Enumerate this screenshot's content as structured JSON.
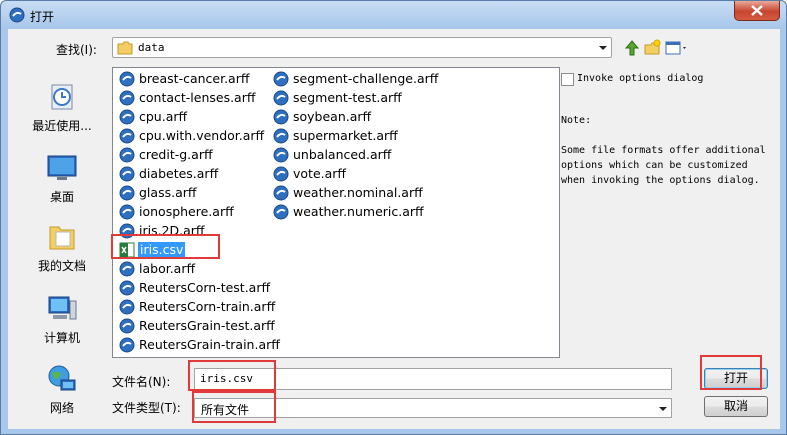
{
  "window": {
    "title": "打开"
  },
  "lookin": {
    "label": "查找(I):",
    "value": "data"
  },
  "places": [
    {
      "label": "最近使用..."
    },
    {
      "label": "桌面"
    },
    {
      "label": "我的文档"
    },
    {
      "label": "计算机"
    },
    {
      "label": "网络"
    }
  ],
  "files": {
    "col1": [
      "breast-cancer.arff",
      "contact-lenses.arff",
      "cpu.arff",
      "cpu.with.vendor.arff",
      "credit-g.arff",
      "diabetes.arff",
      "glass.arff",
      "ionosphere.arff",
      "iris.2D.arff",
      "iris.csv",
      "labor.arff",
      "ReutersCorn-test.arff",
      "ReutersCorn-train.arff",
      "ReutersGrain-test.arff",
      "ReutersGrain-train.arff"
    ],
    "col2": [
      "segment-challenge.arff",
      "segment-test.arff",
      "soybean.arff",
      "supermarket.arff",
      "unbalanced.arff",
      "vote.arff",
      "weather.nominal.arff",
      "weather.numeric.arff"
    ],
    "selected": "iris.csv"
  },
  "options": {
    "invoke_label": "Invoke options dialog",
    "invoke_checked": false,
    "note_title": "Note:",
    "note_text": "Some file formats offer additional options which can be customized when invoking the options dialog."
  },
  "filename": {
    "label": "文件名(N):",
    "value": "iris.csv"
  },
  "filetype": {
    "label": "文件类型(T):",
    "value": "所有文件"
  },
  "buttons": {
    "open": "打开",
    "cancel": "取消"
  },
  "colors": {
    "selection": "#3399ff",
    "highlight": "#e03a3a",
    "window_frame": "#a9c7ea"
  }
}
